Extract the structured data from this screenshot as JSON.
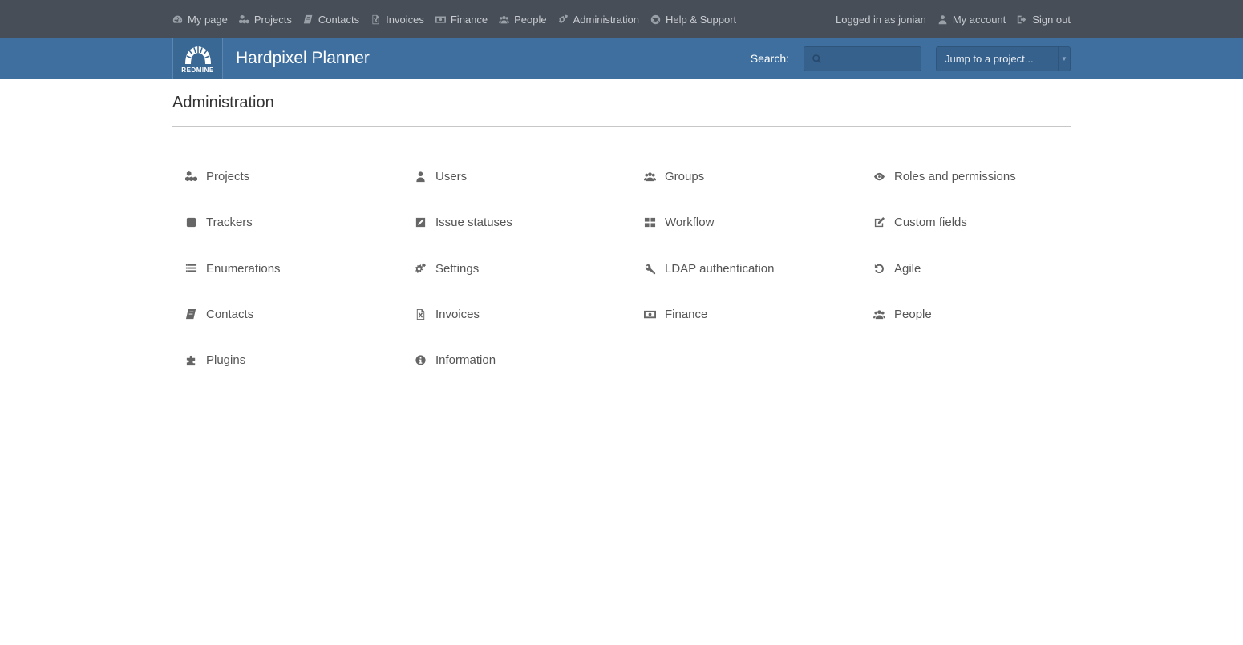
{
  "top_menu": {
    "items": [
      {
        "label": "My page",
        "icon": "dashboard-icon"
      },
      {
        "label": "Projects",
        "icon": "cubes-icon"
      },
      {
        "label": "Contacts",
        "icon": "book-icon"
      },
      {
        "label": "Invoices",
        "icon": "excel-file-icon"
      },
      {
        "label": "Finance",
        "icon": "money-icon"
      },
      {
        "label": "People",
        "icon": "users-icon"
      },
      {
        "label": "Administration",
        "icon": "cogs-icon"
      },
      {
        "label": "Help & Support",
        "icon": "lifebuoy-icon"
      }
    ],
    "logged_in_text": "Logged in as jonian",
    "my_account": "My account",
    "sign_out": "Sign out"
  },
  "header": {
    "logo_text": "REDMINE",
    "site_title": "Hardpixel Planner",
    "search_label": "Search:",
    "search_value": "",
    "jump_label": "Jump to a project...",
    "jump_arrow": "▼"
  },
  "page": {
    "title": "Administration"
  },
  "admin_items": [
    {
      "label": "Projects",
      "icon": "cubes-icon"
    },
    {
      "label": "Users",
      "icon": "user-icon"
    },
    {
      "label": "Groups",
      "icon": "users-icon"
    },
    {
      "label": "Roles and permissions",
      "icon": "eye-icon"
    },
    {
      "label": "Trackers",
      "icon": "square-icon"
    },
    {
      "label": "Issue statuses",
      "icon": "edit-square-icon"
    },
    {
      "label": "Workflow",
      "icon": "grid-icon"
    },
    {
      "label": "Custom fields",
      "icon": "pencil-square-icon"
    },
    {
      "label": "Enumerations",
      "icon": "list-icon"
    },
    {
      "label": "Settings",
      "icon": "cogs-icon"
    },
    {
      "label": "LDAP authentication",
      "icon": "key-icon"
    },
    {
      "label": "Agile",
      "icon": "undo-icon"
    },
    {
      "label": "Contacts",
      "icon": "book-icon"
    },
    {
      "label": "Invoices",
      "icon": "excel-file-icon"
    },
    {
      "label": "Finance",
      "icon": "money-icon"
    },
    {
      "label": "People",
      "icon": "users-icon"
    },
    {
      "label": "Plugins",
      "icon": "puzzle-icon"
    },
    {
      "label": "Information",
      "icon": "info-circle-icon"
    }
  ],
  "colors": {
    "top_menu_bg": "#474e57",
    "header_bg": "#3e6f9f",
    "text": "#555555"
  }
}
